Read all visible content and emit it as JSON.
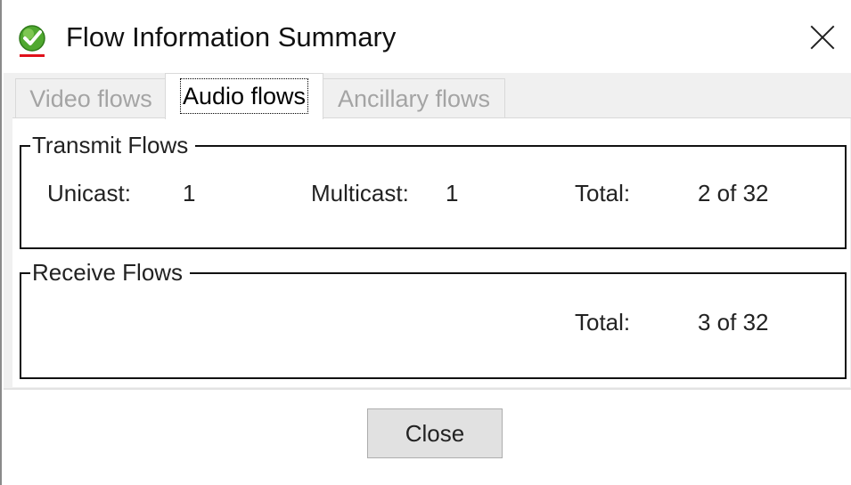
{
  "window": {
    "title": "Flow Information Summary",
    "icon": "green-check-icon",
    "accent_color": "#3f9b2a"
  },
  "tabs": [
    {
      "label": "Video flows",
      "active": false
    },
    {
      "label": "Audio flows",
      "active": true
    },
    {
      "label": "Ancillary flows",
      "active": false
    }
  ],
  "transmit": {
    "legend": "Transmit Flows",
    "unicast_label": "Unicast:",
    "unicast_value": "1",
    "multicast_label": "Multicast:",
    "multicast_value": "1",
    "total_label": "Total:",
    "total_value": "2 of 32"
  },
  "receive": {
    "legend": "Receive Flows",
    "total_label": "Total:",
    "total_value": "3 of 32"
  },
  "footer": {
    "close_label": "Close"
  }
}
